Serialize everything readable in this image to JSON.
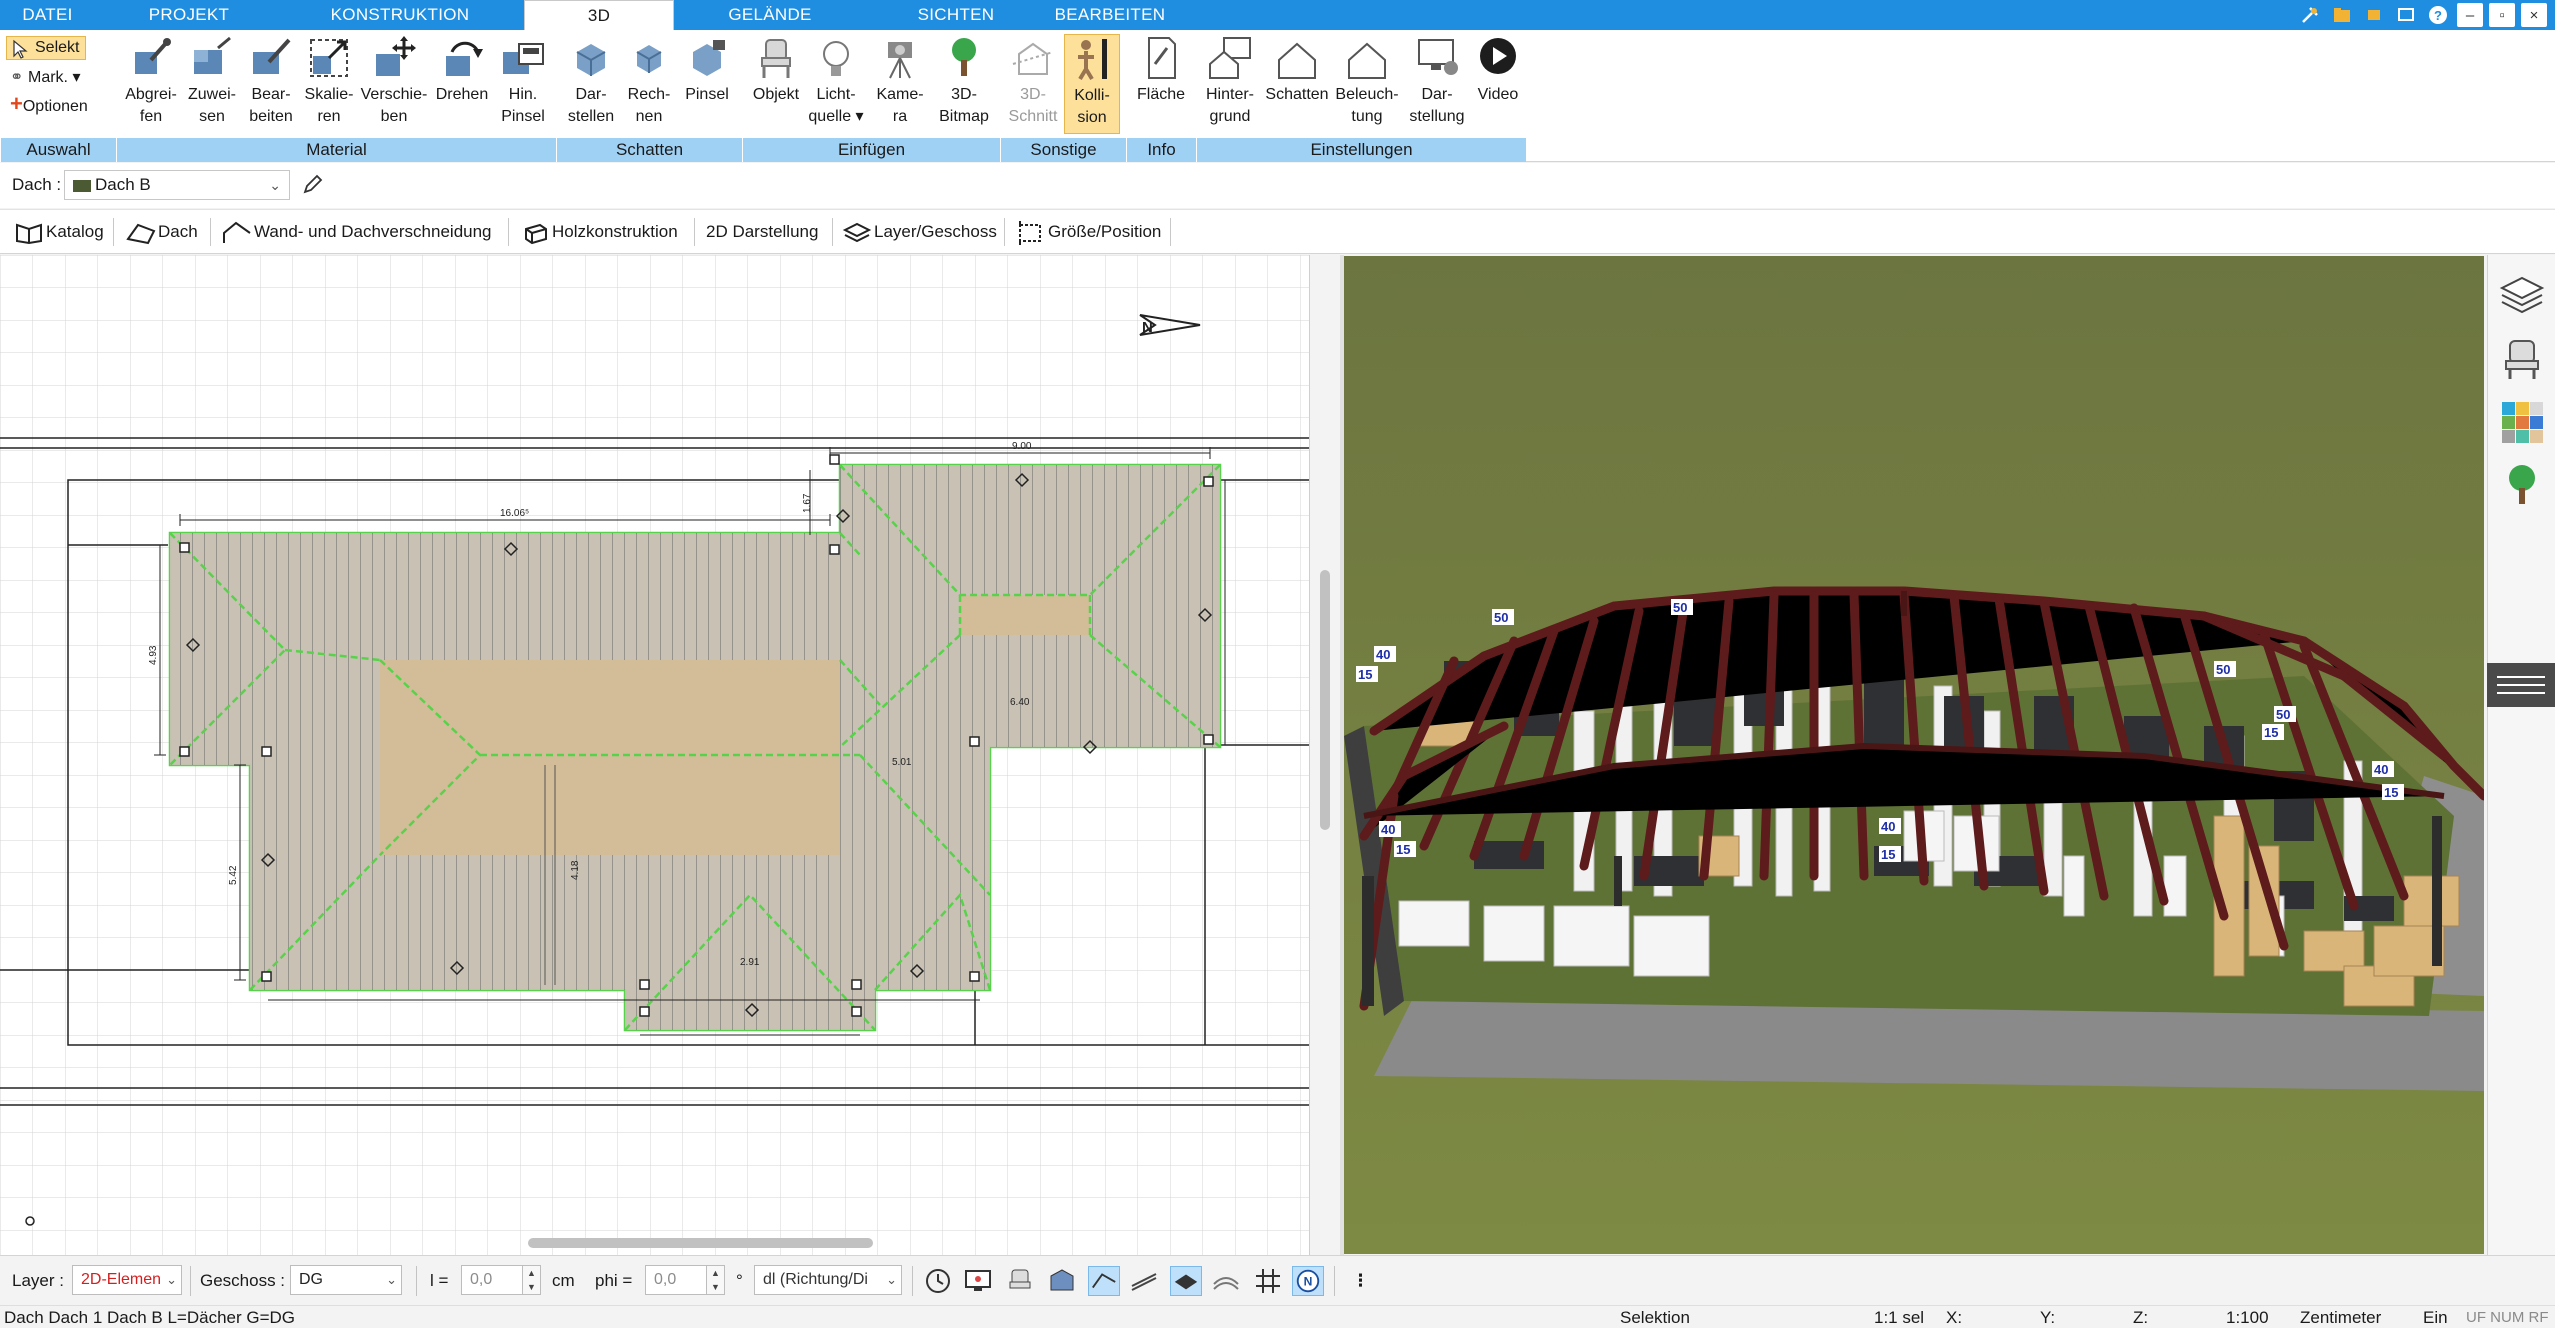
{
  "tabs": [
    {
      "label": "DATEI",
      "active": false
    },
    {
      "label": "PROJEKT",
      "active": false
    },
    {
      "label": "KONSTRUKTION",
      "active": false
    },
    {
      "label": "3D",
      "active": true
    },
    {
      "label": "GELÄNDE",
      "active": false
    },
    {
      "label": "SICHTEN",
      "active": false
    },
    {
      "label": "BEARBEITEN",
      "active": false
    }
  ],
  "ribbon": {
    "auswahl": {
      "label": "Auswahl",
      "selekt": "Selekt",
      "mark": "Mark.",
      "optionen": "Optionen"
    },
    "material": {
      "label": "Material",
      "buttons": [
        {
          "l1": "Abgrei-",
          "l2": "fen",
          "icon": "eyedropper-icon"
        },
        {
          "l1": "Zuwei-",
          "l2": "sen",
          "icon": "assign-material-icon"
        },
        {
          "l1": "Bear-",
          "l2": "beiten",
          "icon": "edit-material-icon"
        },
        {
          "l1": "Skalie-",
          "l2": "ren",
          "icon": "scale-icon"
        },
        {
          "l1": "Verschie-",
          "l2": "ben",
          "icon": "move-icon"
        },
        {
          "l1": "Drehen",
          "l2": "",
          "icon": "rotate-icon"
        },
        {
          "l1": "Hin.",
          "l2": "Pinsel",
          "icon": "background-brush-icon"
        }
      ]
    },
    "schatten": {
      "label": "Schatten",
      "buttons": [
        {
          "l1": "Dar-",
          "l2": "stellen",
          "icon": "shadow-display-icon"
        },
        {
          "l1": "Rech-",
          "l2": "nen",
          "icon": "shadow-calculate-icon"
        },
        {
          "l1": "Pinsel",
          "l2": "",
          "icon": "shadow-brush-icon"
        }
      ]
    },
    "einfuegen": {
      "label": "Einfügen",
      "buttons": [
        {
          "l1": "Objekt",
          "l2": "",
          "icon": "chair-object-icon"
        },
        {
          "l1": "Licht-",
          "l2": "quelle ▾",
          "icon": "lightbulb-icon"
        },
        {
          "l1": "Kame-",
          "l2": "ra",
          "icon": "camera-icon"
        },
        {
          "l1": "3D-",
          "l2": "Bitmap",
          "icon": "tree-bitmap-icon"
        }
      ]
    },
    "sonstige": {
      "label": "Sonstige",
      "buttons": [
        {
          "l1": "3D-",
          "l2": "Schnitt",
          "icon": "section-cut-icon"
        },
        {
          "l1": "Kolli-",
          "l2": "sion",
          "icon": "collision-icon"
        }
      ]
    },
    "info": {
      "label": "Info",
      "buttons": [
        {
          "l1": "Fläche",
          "l2": "",
          "icon": "area-icon"
        }
      ]
    },
    "einstellungen": {
      "label": "Einstellungen",
      "buttons": [
        {
          "l1": "Hinter-",
          "l2": "grund",
          "icon": "background-house-icon"
        },
        {
          "l1": "Schatten",
          "l2": "",
          "icon": "shadow-house-icon"
        },
        {
          "l1": "Beleuch-",
          "l2": "tung",
          "icon": "lighting-house-icon"
        },
        {
          "l1": "Dar-",
          "l2": "stellung",
          "icon": "display-monitor-icon"
        },
        {
          "l1": "Video",
          "l2": "",
          "icon": "play-video-icon"
        }
      ]
    }
  },
  "property": {
    "label": "Dach :",
    "value": "Dach B"
  },
  "subtoolbar": [
    {
      "label": "Katalog",
      "icon": "catalog-icon"
    },
    {
      "label": "Dach",
      "icon": "roof-icon"
    },
    {
      "label": "Wand- und Dachverschneidung",
      "icon": "wall-roof-intersect-icon"
    },
    {
      "label": "Holzkonstruktion",
      "icon": "timber-icon"
    },
    {
      "label": "2D Darstellung",
      "icon": ""
    },
    {
      "label": "Layer/Geschoss",
      "icon": "layers-icon"
    },
    {
      "label": "Größe/Position",
      "icon": "size-position-icon"
    }
  ],
  "plan": {
    "north_label": "N",
    "dims": [
      "9.00",
      "16.06⁵",
      "1.67",
      "4.93",
      "5.42",
      "4.18",
      "6.40",
      "5.01",
      "2.91"
    ]
  },
  "view3d": {
    "labels": [
      "50",
      "50",
      "40",
      "15",
      "40",
      "15",
      "40",
      "15",
      "50",
      "50",
      "15",
      "40",
      "15"
    ]
  },
  "inputbar": {
    "layer_label": "Layer :",
    "layer_value": "2D-Elemen",
    "geschoss_label": "Geschoss :",
    "geschoss_value": "DG",
    "l_label": "l =",
    "l_value": "0,0",
    "l_unit": "cm",
    "phi_label": "phi =",
    "phi_value": "0,0",
    "phi_unit": "°",
    "dl_value": "dl (Richtung/Di"
  },
  "status": {
    "left": "Dach Dach 1 Dach B L=Dächer G=DG",
    "mode": "Selektion",
    "sel": "1:1 sel",
    "x": "X:",
    "y": "Y:",
    "z": "Z:",
    "scale": "1:100",
    "unit": "Zentimeter",
    "ein": "Ein",
    "flags": "UF NUM RF"
  },
  "colors": {
    "accent": "#1f8ee0",
    "group_band": "#9fd1f5",
    "selected": "#fde19b",
    "grass": "#6f7a3a",
    "rafter": "#6e1d1d",
    "roof_tile": "#c9c2b4",
    "ridge": "#58d24a"
  }
}
